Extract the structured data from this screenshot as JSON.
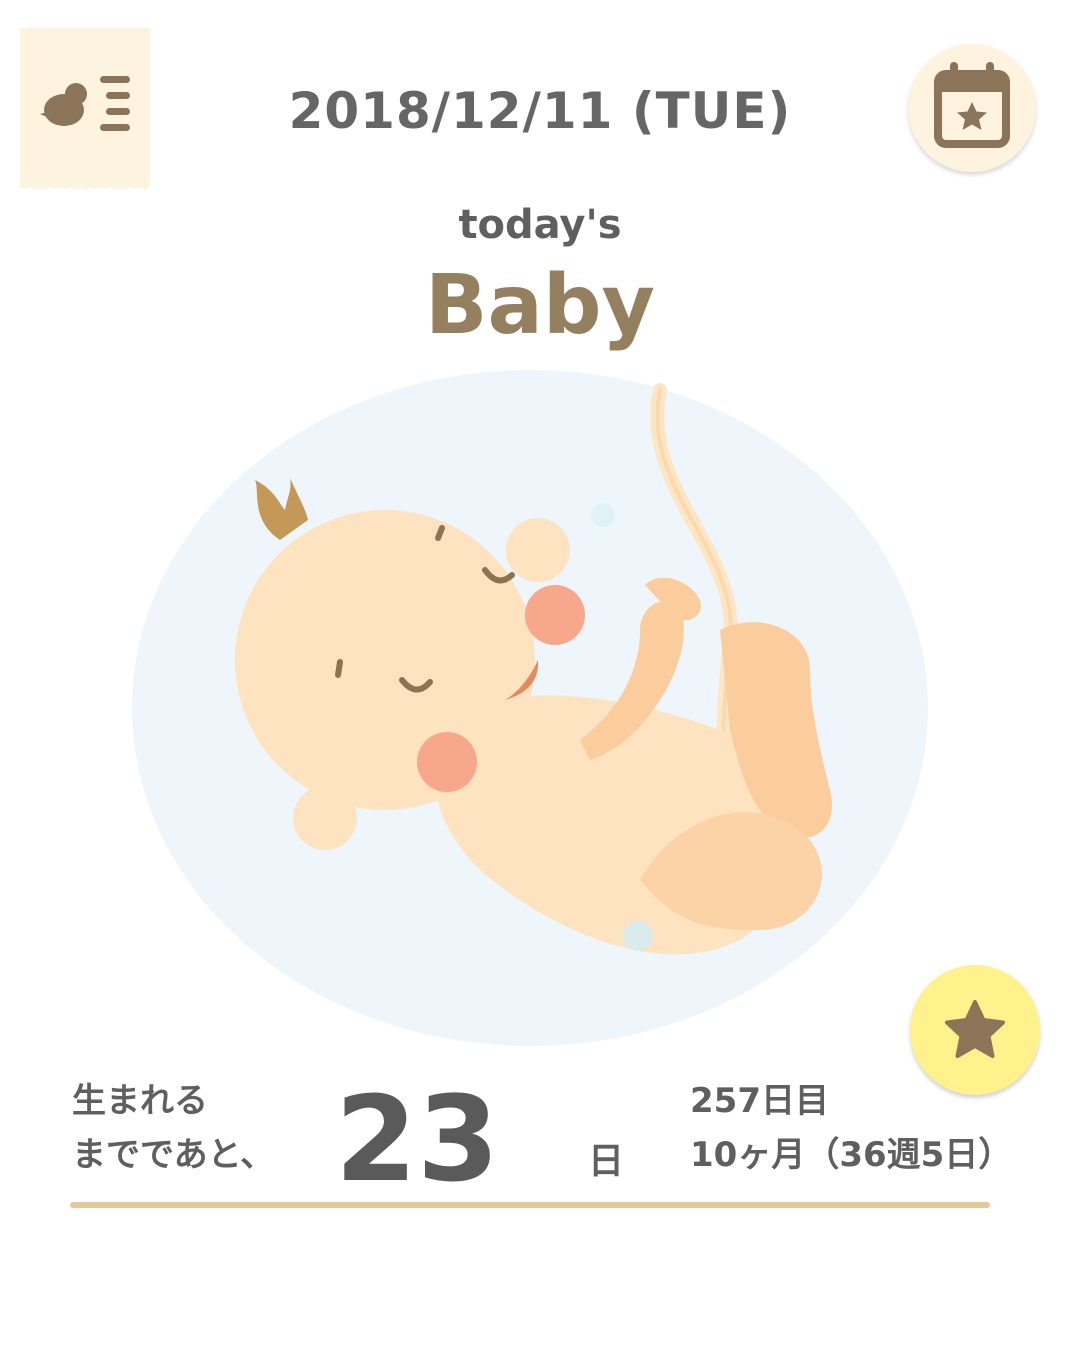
{
  "header": {
    "date": "2018/12/11 (TUE)",
    "menu_icon": "bird-menu-icon",
    "calendar_icon": "calendar-star-icon"
  },
  "main": {
    "subtitle": "today's",
    "title": "Baby",
    "illustration": "fetus-in-womb"
  },
  "favorite": {
    "icon": "star-icon"
  },
  "countdown": {
    "label_line1": "生まれる",
    "label_line2": "までであと、",
    "days": "23",
    "unit": "日",
    "day_count": "257日目",
    "pregnancy_term": "10ヶ月（36週5日）"
  },
  "colors": {
    "accent": "#94805e",
    "tab_bg": "#fdf3de",
    "star_bg": "#fff28c",
    "divider": "#e3c99a",
    "womb_bg": "#eef6fb"
  }
}
